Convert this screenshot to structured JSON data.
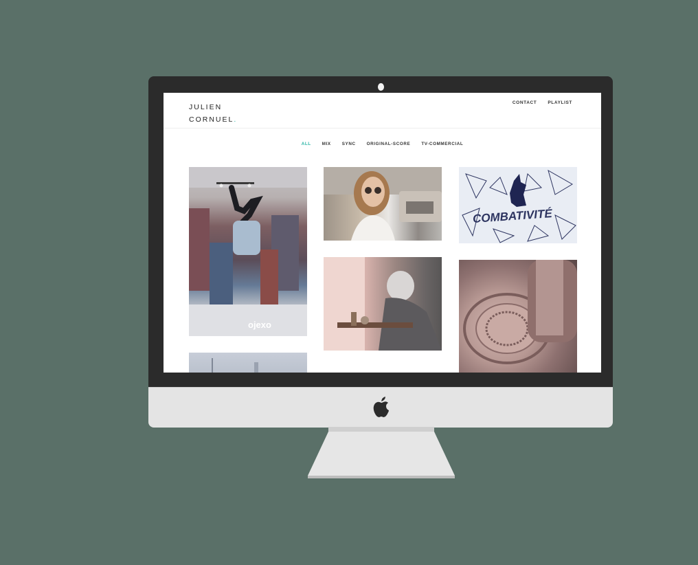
{
  "site": {
    "logo_line1": "JULIEN",
    "logo_line2": "CORNUEL",
    "logo_dot": ".",
    "accent_color": "#2ab5a5"
  },
  "top_nav": {
    "items": [
      {
        "label": "CONTACT"
      },
      {
        "label": "PLAYLIST"
      }
    ]
  },
  "filters": {
    "active_index": 0,
    "items": [
      {
        "label": "ALL"
      },
      {
        "label": "MIX"
      },
      {
        "label": "SYNC"
      },
      {
        "label": "ORIGINAL-SCORE"
      },
      {
        "label": "TV-COMMERCIAL"
      }
    ]
  },
  "portfolio": {
    "tile1_overlay": "ojexo",
    "tile3_overlay": "COMBATIVITÉ"
  },
  "icons": {
    "hardware": "apple-logo-icon",
    "camera": "camera-icon"
  }
}
